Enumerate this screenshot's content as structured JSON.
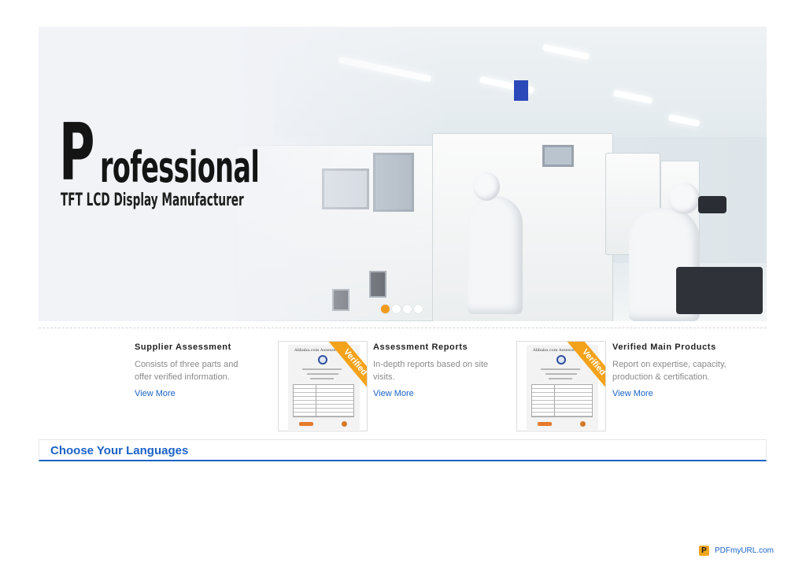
{
  "hero": {
    "headline_initial": "P",
    "headline_rest": "rofessional",
    "subheadline": "TFT LCD Display Manufacturer",
    "slide_count": 4,
    "active_slide": 1,
    "active_dot_color": "#f39a1e"
  },
  "features": [
    {
      "title": "Supplier Assessment",
      "desc_line1": "Consists of three parts and",
      "desc_line2": "offer verified information.",
      "link": "View More"
    },
    {
      "title": "Assessment Reports",
      "desc_line1": "In-depth reports based on site",
      "desc_line2": "visits.",
      "link": "View More",
      "thumb_doc_title": "Alibaba.com Assessed Su",
      "ribbon": "Verified"
    },
    {
      "title": "Verified Main Products",
      "desc_line1": "Report on expertise, capacity,",
      "desc_line2": "production & certification.",
      "link": "View More",
      "thumb_doc_title": "Alibaba.com Assessed Su",
      "ribbon": "Verified"
    }
  ],
  "languages": {
    "title": "Choose Your Languages"
  },
  "footer": {
    "badge_icon_text": "P",
    "badge_text": "PDFmyURL.com"
  },
  "colors": {
    "link_blue": "#1a63c7",
    "ribbon_orange": "#f5a21b"
  }
}
